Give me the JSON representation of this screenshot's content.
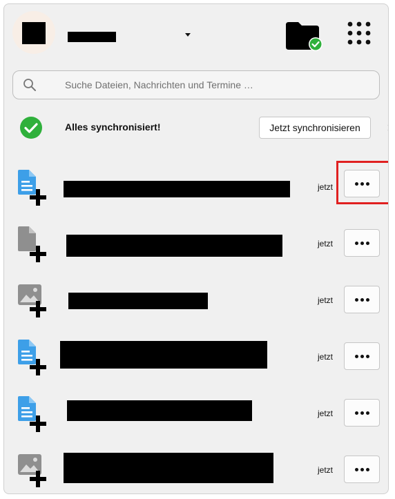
{
  "header": {
    "avatar_icon": "avatar-placeholder",
    "folder_status_icon": "folder-synced-icon",
    "apps_icon": "apps-grid-icon"
  },
  "search": {
    "placeholder": "Suche Dateien, Nachrichten und Termine …"
  },
  "sync": {
    "status": "Alles synchronisiert!",
    "button_label": "Jetzt synchronisieren",
    "status_color": "#2fb03b"
  },
  "activities": [
    {
      "file_type": "document",
      "time": "jetzt"
    },
    {
      "file_type": "file",
      "time": "jetzt"
    },
    {
      "file_type": "image",
      "time": "jetzt"
    },
    {
      "file_type": "document",
      "time": "jetzt"
    },
    {
      "file_type": "document",
      "time": "jetzt"
    },
    {
      "file_type": "image",
      "time": "jetzt"
    }
  ],
  "colors": {
    "doc_blue": "#3d9fe8",
    "gray_file": "#8f8f8f",
    "highlight": "#e02020",
    "green": "#2fb03b"
  }
}
